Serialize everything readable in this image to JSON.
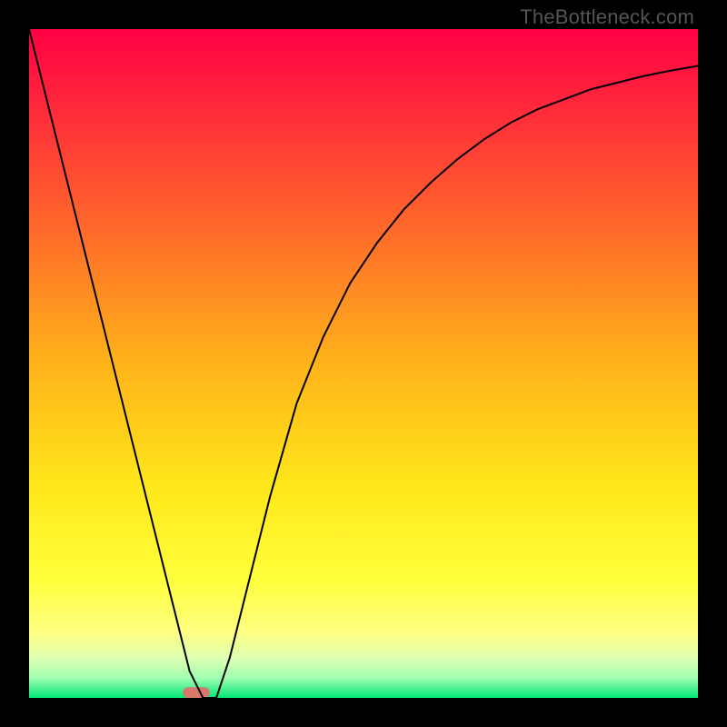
{
  "watermark": "TheBottleneck.com",
  "chart_data": {
    "type": "line",
    "title": "",
    "xlabel": "",
    "ylabel": "",
    "xlim": [
      0,
      100
    ],
    "ylim": [
      0,
      100
    ],
    "legend": false,
    "grid": false,
    "background_gradient": {
      "stops": [
        {
          "offset": 0.0,
          "color": "#ff0044"
        },
        {
          "offset": 0.12,
          "color": "#ff2a3a"
        },
        {
          "offset": 0.3,
          "color": "#ff6a2a"
        },
        {
          "offset": 0.5,
          "color": "#ffb31a"
        },
        {
          "offset": 0.68,
          "color": "#ffe61a"
        },
        {
          "offset": 0.82,
          "color": "#ffff3a"
        },
        {
          "offset": 0.9,
          "color": "#ffff80"
        },
        {
          "offset": 0.94,
          "color": "#dfffb0"
        },
        {
          "offset": 0.97,
          "color": "#a0ffb0"
        },
        {
          "offset": 1.0,
          "color": "#00e676"
        }
      ]
    },
    "series": [
      {
        "name": "bottleneck-curve",
        "color": "#000000",
        "width": 2,
        "x": [
          0,
          2,
          4,
          6,
          8,
          10,
          12,
          14,
          16,
          18,
          20,
          22,
          24,
          26,
          28,
          30,
          32,
          34,
          36,
          38,
          40,
          44,
          48,
          52,
          56,
          60,
          64,
          68,
          72,
          76,
          80,
          84,
          88,
          92,
          96,
          100
        ],
        "y": [
          100,
          92,
          84,
          76,
          68,
          60,
          52,
          44,
          36,
          28,
          20,
          12,
          4,
          0,
          0,
          6,
          14,
          22,
          30,
          37,
          44,
          54,
          62,
          68,
          73,
          77,
          80.5,
          83.5,
          86,
          88,
          89.5,
          91,
          92,
          93,
          93.8,
          94.5
        ]
      }
    ],
    "marker": {
      "name": "min-marker",
      "shape": "capsule",
      "x": 25,
      "y": 0,
      "width": 4,
      "height": 1.6,
      "color": "#d9776b"
    }
  }
}
